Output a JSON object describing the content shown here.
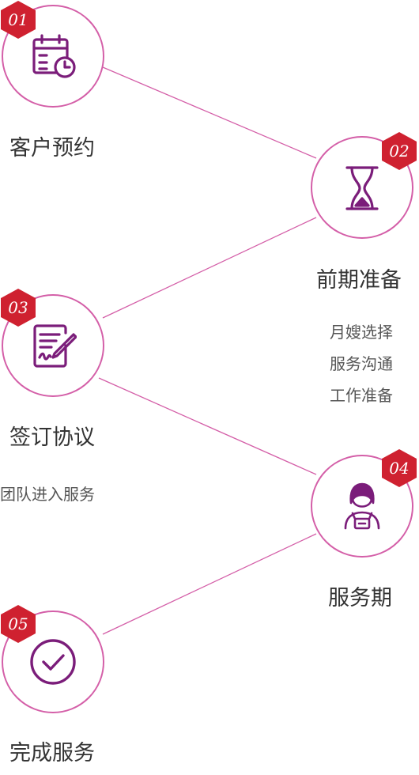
{
  "colors": {
    "line": "#d45fa8",
    "circle_border": "#d45fa8",
    "badge": "#cf2130",
    "icon": "#7b1d7a"
  },
  "steps": [
    {
      "number": "01",
      "title": "客户预约",
      "icon": "calendar-clock-icon",
      "details": []
    },
    {
      "number": "02",
      "title": "前期准备",
      "icon": "hourglass-icon",
      "details": [
        "月嫂选择",
        "服务沟通",
        "工作准备"
      ]
    },
    {
      "number": "03",
      "title": "签订协议",
      "icon": "contract-sign-icon",
      "details": [
        "团队进入服务"
      ]
    },
    {
      "number": "04",
      "title": "服务期",
      "icon": "nanny-icon",
      "details": []
    },
    {
      "number": "05",
      "title": "完成服务",
      "icon": "check-circle-icon",
      "details": []
    }
  ]
}
